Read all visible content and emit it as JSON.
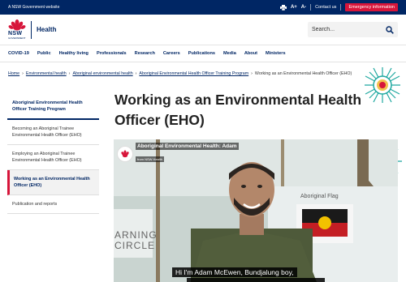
{
  "topbar": {
    "government_text": "A NSW Government website",
    "tools": {
      "print_icon": "printer-icon",
      "text_larger": "A+",
      "text_smaller": "A-"
    },
    "contact_label": "Contact us",
    "emergency_label": "Emergency information"
  },
  "header": {
    "logo_wordmark": "NSW",
    "logo_sub": "GOVERNMENT",
    "health_label": "Health",
    "search_placeholder": "Search..."
  },
  "nav": {
    "items": [
      "COVID-19",
      "Public",
      "Healthy living",
      "Professionals",
      "Research",
      "Careers",
      "Publications",
      "Media",
      "About",
      "Ministers"
    ]
  },
  "breadcrumb": {
    "items": [
      "Home",
      "Environmental health",
      "Aboriginal environmental health",
      "Aboriginal Environmental Health Officer Training Program"
    ],
    "current": "Working as an Environmental Health Officer (EHO)"
  },
  "sidebar": {
    "heading": "Aboriginal Environmental Health Officer Training Program",
    "items": [
      "Becoming an Aboriginal Trainee Environmental Health Officer (EHO)",
      "Employing an Aboriginal Trainee Environmental Health Officer (EHO)",
      "Working as an Environmental Health Officer (EHO)",
      "Publication and reports"
    ],
    "active_index": 2
  },
  "main": {
    "title": "Working as an Environmental Health Officer (EHO)"
  },
  "video": {
    "channel_title": "Aboriginal Environmental Health: Adam",
    "channel_sub": "from NSW Health",
    "background_sign_1": "Aboriginal Flag",
    "background_sign_2": "ARNING CIRCLE",
    "caption_line_1": "Hi I'm Adam McEwen, Bundjalung boy,"
  },
  "colors": {
    "navy": "#002664",
    "red": "#d7153a",
    "teal_dot": "#1fa8a0"
  }
}
